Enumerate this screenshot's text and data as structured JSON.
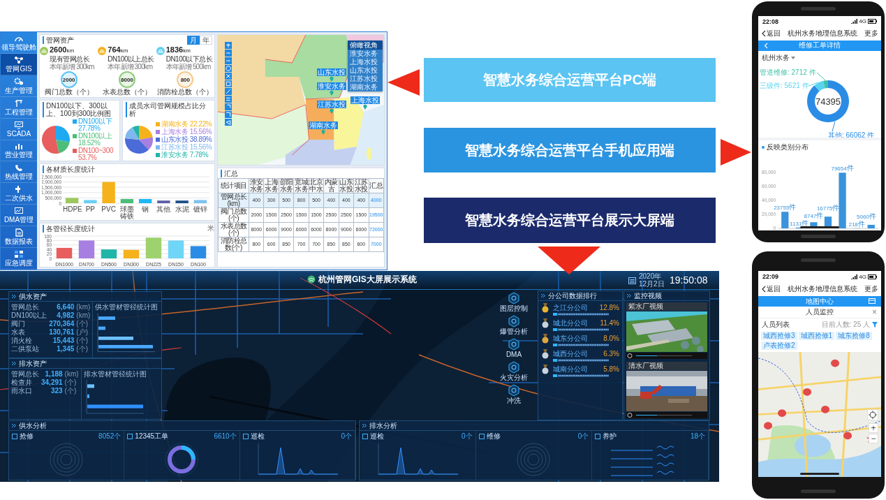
{
  "pc": {
    "sidebar": [
      {
        "label": "领导驾驶舱",
        "selected": false
      },
      {
        "label": "管网GIS",
        "selected": true
      },
      {
        "label": "生产管理",
        "selected": false
      },
      {
        "label": "工程管理",
        "selected": false
      },
      {
        "label": "SCADA",
        "selected": false
      },
      {
        "label": "营业管理",
        "selected": false
      },
      {
        "label": "热线管理",
        "selected": false
      },
      {
        "label": "二次供水",
        "selected": false
      },
      {
        "label": "DMA管理",
        "selected": false
      },
      {
        "label": "数据报表",
        "selected": false
      },
      {
        "label": "应急调度",
        "selected": false
      }
    ],
    "assets": {
      "title": "管网资产",
      "toggle": [
        {
          "label": "月",
          "selected": true
        },
        {
          "label": "年",
          "selected": false
        }
      ],
      "stats": [
        {
          "value": "2600",
          "unit": "km",
          "label": "现有管网总长",
          "note": "本年新增 300km",
          "color": "#9dc85e"
        },
        {
          "value": "764",
          "unit": "km",
          "label": "DN100以上总长",
          "note": "本年新增 300km",
          "color": "#f5b21b"
        },
        {
          "value": "1836",
          "unit": "km",
          "label": "DN100以下总长",
          "note": "本年新增 500km",
          "color": "#66d0f5"
        }
      ],
      "counts": [
        {
          "value": "2000",
          "label": "阀门总数（个）",
          "color": "#5bc4f2"
        },
        {
          "value": "8000",
          "label": "水表总数（个）",
          "color": "#8fcc7c"
        },
        {
          "value": "800",
          "label": "消防栓总数（个）",
          "color": "#f5c98c"
        }
      ]
    },
    "ratio": {
      "title": "DN100以下、300以上、100到300比例图",
      "chart_data": {
        "type": "pie",
        "categories": [
          "DN100以下",
          "DN100以上",
          "DN100~300"
        ],
        "values": [
          27.78,
          18.52,
          53.7
        ],
        "legend": "right",
        "value_labels": [
          "27.78%",
          "18.52%",
          "53.7%"
        ]
      }
    },
    "share": {
      "title": "成员水司管网规模占比分析",
      "chart_data": {
        "type": "pie",
        "categories": [
          "湖南水务",
          "上海水务",
          "山东水投",
          "江苏水投",
          "淮安水务"
        ],
        "values": [
          22.22,
          15.56,
          38.89,
          15.56,
          7.78
        ],
        "legend": "right",
        "value_labels": [
          "22.22%",
          "15.56%",
          "38.89%",
          "15.56%",
          "7.78%"
        ]
      }
    },
    "material": {
      "title": "各材质长度统计",
      "chart_data": {
        "type": "bar",
        "categories": [
          "HDPE",
          "PP",
          "PVC",
          "球墨铸铁",
          "钢",
          "其他",
          "水泥",
          "镀锌"
        ],
        "values": [
          500000,
          300000,
          2000000,
          400000,
          400000,
          250000,
          250000,
          300000
        ],
        "grid": true,
        "ylim": [
          0,
          2500000
        ],
        "yticks": [
          {
            "value": 0,
            "label": "0"
          },
          {
            "value": 500000,
            "label": "500,000"
          },
          {
            "value": 1000000,
            "label": "1,000,000"
          },
          {
            "value": 1500000,
            "label": "1,500,000"
          },
          {
            "value": 2000000,
            "label": "2,000,000"
          },
          {
            "value": 2500000,
            "label": "2,500,000"
          }
        ]
      }
    },
    "diameter": {
      "title": "各管径长度统计",
      "chart_data": {
        "type": "bar",
        "ylabel": "米",
        "categories": [
          "DN1000",
          "DN700",
          "DN500",
          "DN300",
          "DN225",
          "DN150",
          "DN100"
        ],
        "values": [
          47,
          80,
          40,
          38,
          93,
          80,
          55
        ],
        "grid": true,
        "ylim": [
          0,
          100
        ],
        "yticks": [
          0,
          20,
          40,
          60,
          80,
          100
        ]
      }
    },
    "map": {
      "view_menu": {
        "title": "俯瞰视角",
        "items": [
          "淮安水务",
          "上海水投",
          "山东水投",
          "江苏水投",
          "湖南水务"
        ]
      },
      "markers": [
        "山东水投",
        "淮安水务",
        "上海水投",
        "江苏水投",
        "湖南水务"
      ]
    },
    "summary": {
      "title": "汇总",
      "columns": [
        "统计项目",
        "淮安水务",
        "上海水务",
        "邵阳水务",
        "宽城水务",
        "北京中水",
        "内蒙古",
        "山东水投",
        "江苏水投",
        "汇总"
      ],
      "rows": [
        {
          "selected": true,
          "cells": [
            "管网总长(km)",
            "400",
            "300",
            "500",
            "800",
            "500",
            "400",
            "400",
            "400",
            "4000"
          ]
        },
        {
          "selected": false,
          "cells": [
            "阀门总数(个)",
            "2000",
            "1500",
            "2500",
            "1500",
            "1500",
            "2500",
            "2500",
            "1500",
            "19500"
          ]
        },
        {
          "selected": false,
          "cells": [
            "水表总数(个)",
            "8000",
            "6000",
            "9000",
            "6000",
            "6000",
            "8000",
            "9000",
            "6000",
            "72000"
          ]
        },
        {
          "selected": false,
          "cells": [
            "消防栓总数(个)",
            "800",
            "600",
            "850",
            "700",
            "700",
            "850",
            "850",
            "600",
            "7000"
          ]
        }
      ]
    }
  },
  "banners": [
    {
      "label": "智慧水务综合运营平台PC端",
      "color": "#5bc4f2"
    },
    {
      "label": "智慧水务综合运营平台手机应用端",
      "color": "#2b94e0"
    },
    {
      "label": "智慧水务综合运营平台展示大屏端",
      "color": "#1b2a6b"
    }
  ],
  "big": {
    "title": "杭州管网GIS大屏展示系统",
    "date": "2020年12月2日",
    "time": "19:50:08",
    "supply_assets": {
      "title": "供水资产",
      "chart_title": "供水管材管径统计图",
      "stats": [
        {
          "label": "管网总长",
          "value": "6,640",
          "unit": "(km)"
        },
        {
          "label": "DN100以上",
          "value": "4,982",
          "unit": "(km)"
        },
        {
          "label": "阀门",
          "value": "270,364",
          "unit": "(个)"
        },
        {
          "label": "水表",
          "value": "130,761",
          "unit": "(户)"
        },
        {
          "label": "消火栓",
          "value": "15,443",
          "unit": "(个)"
        },
        {
          "label": "二供泵站",
          "value": "1,345",
          "unit": "(个)"
        }
      ]
    },
    "drain_assets": {
      "title": "排水资产",
      "chart_title": "排水管材管径统计图",
      "stats": [
        {
          "label": "管网总长",
          "value": "1,188",
          "unit": "(km)"
        },
        {
          "label": "检查井",
          "value": "34,291",
          "unit": "(个)"
        },
        {
          "label": "雨水口",
          "value": "323",
          "unit": "(个)"
        }
      ]
    },
    "tools": [
      "图层控制",
      "爆管分析",
      "DMA",
      "火灾分析",
      "冲洗"
    ],
    "ranking": {
      "title": "分公司数据排行",
      "rows": [
        {
          "name": "之江分公司",
          "value": "12.8%",
          "color": "#e8b530"
        },
        {
          "name": "城北分公司",
          "value": "11.4%",
          "color": "#c9d3dc"
        },
        {
          "name": "城东分公司",
          "value": "8.0%",
          "color": "#e0a640"
        },
        {
          "name": "城西分公司",
          "value": "6.3%",
          "color": "#c9d3dc"
        },
        {
          "name": "城南分公司",
          "value": "5.8%",
          "color": "#c9d3dc"
        }
      ]
    },
    "monitor": {
      "title": "监控视频",
      "videos": [
        "紫水厂视频",
        "清水厂视频"
      ]
    },
    "supply_analysis": {
      "title": "供水分析",
      "sections": [
        {
          "name": "抢修",
          "count": "8052个",
          "kind": "rings"
        },
        {
          "name": "12345工单",
          "count": "6610个",
          "kind": "donut"
        },
        {
          "name": "巡检",
          "count": "0个",
          "kind": "line"
        }
      ]
    },
    "drain_analysis": {
      "title": "排水分析",
      "sections": [
        {
          "name": "巡检",
          "count": "0个",
          "kind": "line"
        },
        {
          "name": "维修",
          "count": "0个",
          "kind": "rings"
        },
        {
          "name": "养护",
          "count": "18个",
          "kind": "waves"
        }
      ]
    }
  },
  "phone_stats": {
    "time": "22:08",
    "network": "4G",
    "back": "返回",
    "title": "杭州水务地理信息系统",
    "more": "更多",
    "header": "维修工单详情",
    "filter": "杭州水务",
    "total": "74395",
    "donut": {
      "chart_data": {
        "type": "donut",
        "values": [
          66062,
          5621,
          2712
        ],
        "value_labels": [
          "其他: 66062 件",
          "三级件: 5621 件",
          "管道维修: 2712 件"
        ]
      }
    },
    "chart": {
      "title": "反映类别分布",
      "chart_data": {
        "type": "bar",
        "values": [
          23755,
          1131,
          8747,
          16775,
          79654,
          218,
          5060
        ],
        "value_labels": [
          "23755件",
          "1131件",
          "8747件",
          "16775件",
          "79654件",
          "218件",
          "5060件"
        ],
        "ylim": [
          0,
          80000
        ],
        "yticks": [
          {
            "value": 0,
            "label": "0"
          },
          {
            "value": 20000,
            "label": "20,000"
          },
          {
            "value": 40000,
            "label": "40,000"
          },
          {
            "value": 60000,
            "label": "60,000"
          },
          {
            "value": 80000,
            "label": "80,000"
          }
        ]
      }
    }
  },
  "phone_map": {
    "time": "22:09",
    "network": "4G",
    "back": "返回",
    "title": "杭州水务地理信息系统",
    "more": "更多",
    "header": "地图中心",
    "panel_title": "人员监控",
    "close": "×",
    "list_label": "人员列表",
    "count": "目前人数: 25 人",
    "chips": [
      "城西抢修3",
      "城西抢修1",
      "城东抢修8",
      "卢表抢修2"
    ],
    "zoom_in": "+",
    "zoom_out": "−"
  }
}
